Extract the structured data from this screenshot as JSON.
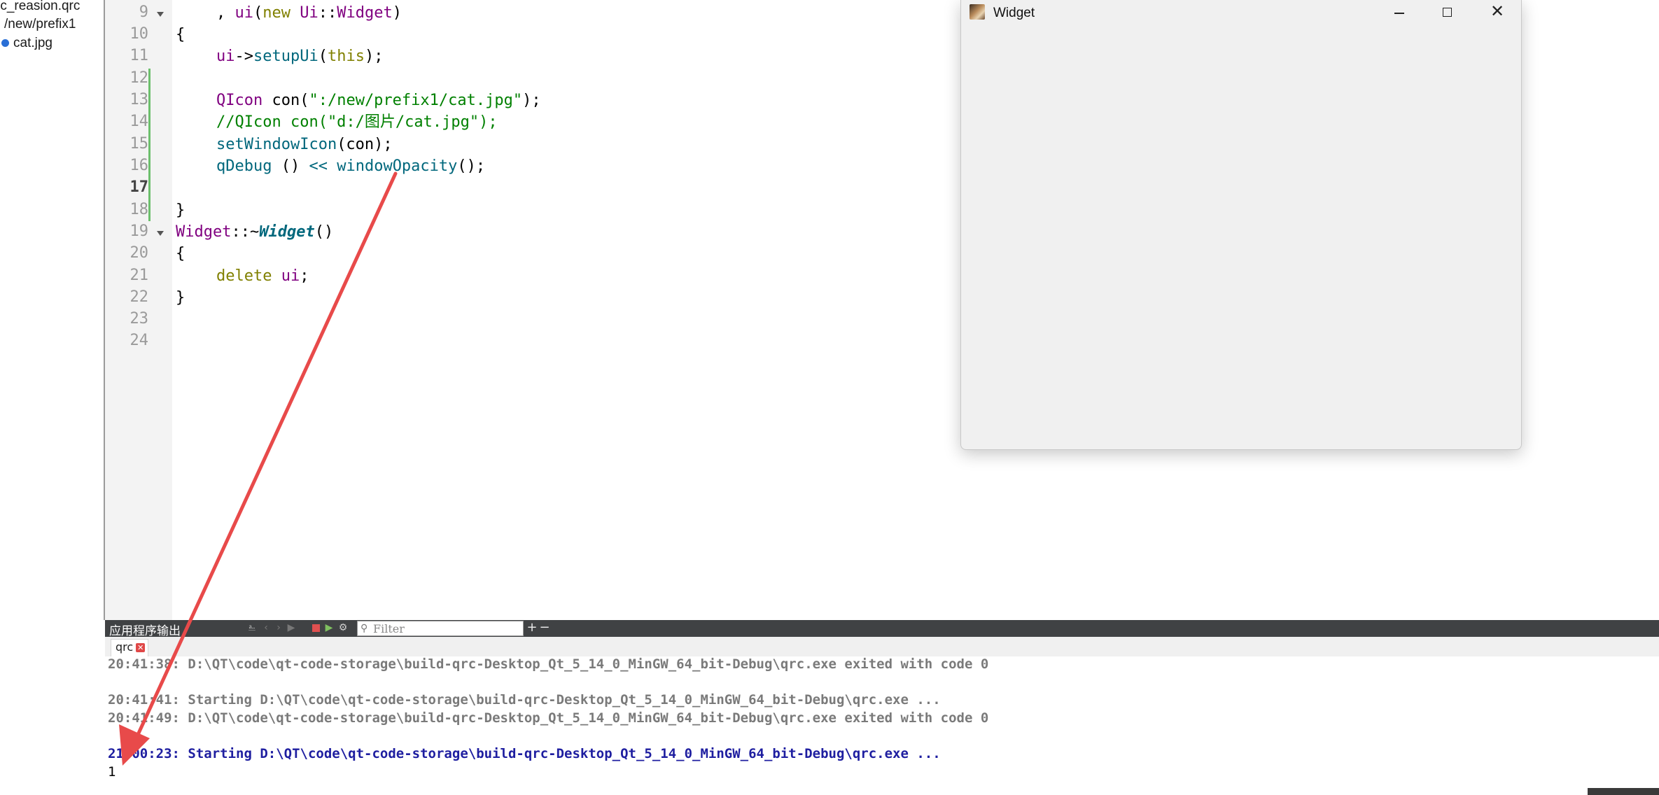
{
  "tree": {
    "items": [
      {
        "label": "rc_reasion.qrc"
      },
      {
        "label": "/new/prefix1"
      },
      {
        "label": "cat.jpg"
      }
    ]
  },
  "editor": {
    "lines": [
      {
        "number": "9"
      },
      {
        "number": "10"
      },
      {
        "number": "11"
      },
      {
        "number": "12"
      },
      {
        "number": "13"
      },
      {
        "number": "14"
      },
      {
        "number": "15"
      },
      {
        "number": "16"
      },
      {
        "number": "17"
      },
      {
        "number": "18"
      },
      {
        "number": "19"
      },
      {
        "number": "20"
      },
      {
        "number": "21"
      },
      {
        "number": "22"
      },
      {
        "number": "23"
      },
      {
        "number": "24"
      }
    ],
    "current_line": "17",
    "code": {
      "l9_a": ", ",
      "l9_b": "ui",
      "l9_c": "(",
      "l9_d": "new",
      "l9_e": " ",
      "l9_f": "Ui",
      "l9_g": "::",
      "l9_h": "Widget",
      "l9_i": ")",
      "l10": "{",
      "l11_a": "ui",
      "l11_b": "->",
      "l11_c": "setupUi",
      "l11_d": "(",
      "l11_e": "this",
      "l11_f": ");",
      "l13_a": "QIcon",
      "l13_b": " con(",
      "l13_c": "\":/new/prefix1/cat.jpg\"",
      "l13_d": ");",
      "l14": "//QIcon con(\"d:/图片/cat.jpg\");",
      "l15_a": "setWindowIcon",
      "l15_b": "(con);",
      "l16_a": "qDebug",
      "l16_b": " () ",
      "l16_c": "<<",
      "l16_d": " ",
      "l16_e": "windowOpacity",
      "l16_f": "();",
      "l18": "}",
      "l19_a": "Widget",
      "l19_b": "::~",
      "l19_c": "Widget",
      "l19_d": "()",
      "l20": "{",
      "l21_a": "delete",
      "l21_b": " ",
      "l21_c": "ui",
      "l21_d": ";",
      "l22": "}"
    }
  },
  "widget_window": {
    "title": "Widget",
    "minimize_glyph": "—",
    "close_glyph": "✕"
  },
  "output_pane": {
    "title": "应用程序输出",
    "filter_placeholder": "Filter",
    "add_glyph": "+",
    "remove_glyph": "−",
    "tab_label": "qrc",
    "tab_close_glyph": "✕",
    "lines": [
      "20:41:38: D:\\QT\\code\\qt-code-storage\\build-qrc-Desktop_Qt_5_14_0_MinGW_64_bit-Debug\\qrc.exe exited with code 0",
      "20:41:41: Starting D:\\QT\\code\\qt-code-storage\\build-qrc-Desktop_Qt_5_14_0_MinGW_64_bit-Debug\\qrc.exe ...",
      "20:41:49: D:\\QT\\code\\qt-code-storage\\build-qrc-Desktop_Qt_5_14_0_MinGW_64_bit-Debug\\qrc.exe exited with code 0",
      "21:00:23: Starting D:\\QT\\code\\qt-code-storage\\build-qrc-Desktop_Qt_5_14_0_MinGW_64_bit-Debug\\qrc.exe ...",
      "1"
    ]
  },
  "colors": {
    "keyword": "#808000",
    "purple": "#800080",
    "function": "#00677c",
    "string": "#008000",
    "output_blue": "#1e1ea0",
    "annotation_arrow": "#e84a4a"
  },
  "icons": {
    "tree_file": "qrc-file-icon",
    "widget_app": "cat-thumbnail-icon",
    "output_tools": [
      "attach-icon",
      "prev-icon",
      "next-icon",
      "run-icon",
      "stop-icon",
      "debug-run-icon",
      "settings-icon"
    ]
  }
}
